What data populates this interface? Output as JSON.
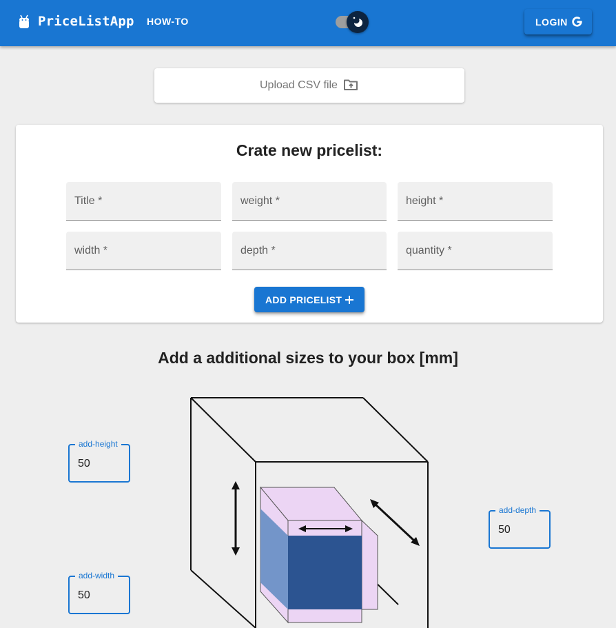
{
  "appbar": {
    "brand": "PriceListApp",
    "howto_label": "HOW-TO",
    "login_label": "LOGIN",
    "icons": {
      "logo": "android-icon",
      "theme": "moon-icon",
      "login": "google-icon"
    },
    "colors": {
      "primary": "#1976d2",
      "switch_thumb": "#0d2440"
    }
  },
  "upload": {
    "label": "Upload CSV file",
    "icon": "folder-upload-icon"
  },
  "create_form": {
    "title": "Crate new pricelist:",
    "fields": [
      {
        "label": "Title *"
      },
      {
        "label": "weight *"
      },
      {
        "label": "height *"
      },
      {
        "label": "width *"
      },
      {
        "label": "depth *"
      },
      {
        "label": "quantity *"
      }
    ],
    "add_button_label": "ADD PRICELIST",
    "add_button_icon": "plus-icon"
  },
  "box_section": {
    "title": "Add a additional sizes to your box [mm]",
    "add_height": {
      "label": "add-height",
      "value": "50"
    },
    "add_width": {
      "label": "add-width",
      "value": "50"
    },
    "add_depth": {
      "label": "add-depth",
      "value": "50"
    },
    "colors": {
      "inner_box": "#ecd5f4",
      "front_face": "#2c5491",
      "side_face": "#7395c9"
    }
  }
}
